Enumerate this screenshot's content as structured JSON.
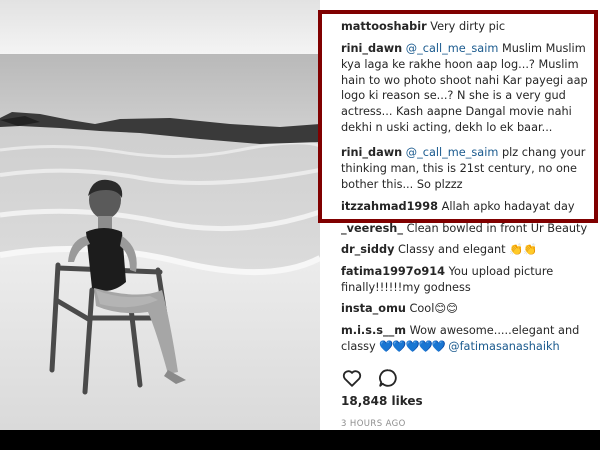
{
  "comments": [
    {
      "user": "mattooshabir",
      "mention": "",
      "text": "Very dirty pic"
    },
    {
      "user": "rini_dawn",
      "mention": "@_call_me_saim",
      "text": "Muslim Muslim kya laga ke rakhe hoon aap log...? Muslim hain to wo photo shoot nahi Kar payegi aap logo ki reason se...? N she is a very gud actress... Kash aapne Dangal movie nahi dekhi n uski acting, dekh lo ek baar..."
    },
    {
      "user": "rini_dawn",
      "mention": "@_call_me_saim",
      "text": "plz chang your thinking man, this is 21st century, no one bother this... So plzzz"
    },
    {
      "user": "itzzahmad1998",
      "mention": "",
      "text": "Allah apko hadayat day"
    },
    {
      "user": "_veeresh_",
      "mention": "",
      "text": "Clean bowled in front Ur Beauty"
    },
    {
      "user": "dr_siddy",
      "mention": "",
      "text": "Classy and elegant 👏👏"
    },
    {
      "user": "fatima1997o914",
      "mention": "",
      "text": "You upload picture finally!!!!!!my godness"
    },
    {
      "user": "insta_omu",
      "mention": "",
      "text": "Cool😊😊"
    },
    {
      "user": "m.i.s.s__m",
      "mention": "",
      "text": "Wow awesome.....elegant and classy",
      "hearts": "💙💙💙💙💙",
      "tag": "@fatimasanashaikh"
    }
  ],
  "actions": {
    "like_icon": "heart-icon",
    "comment_icon": "comment-bubble-icon",
    "likes": "18,848 likes",
    "time_ago": "3 HOURS AGO"
  },
  "photo": {
    "description_icon": "beach-photo"
  }
}
